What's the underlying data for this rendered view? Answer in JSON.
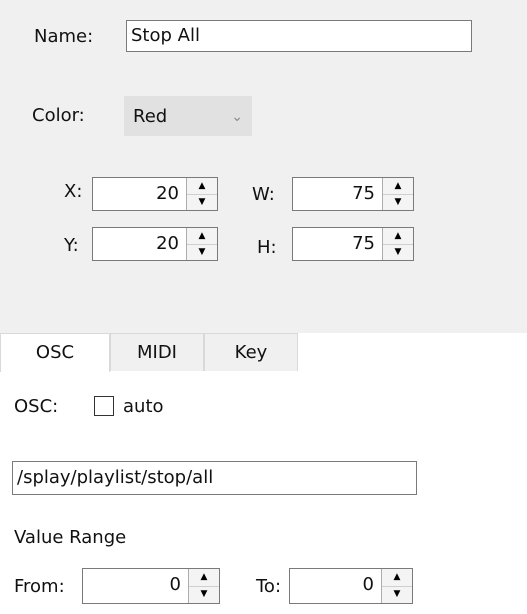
{
  "name": {
    "label": "Name:",
    "value": "Stop All"
  },
  "color": {
    "label": "Color:",
    "value": "Red"
  },
  "position": {
    "x_label": "X:",
    "x_value": "20",
    "y_label": "Y:",
    "y_value": "20",
    "w_label": "W:",
    "w_value": "75",
    "h_label": "H:",
    "h_value": "75"
  },
  "tabs": [
    {
      "label": "OSC",
      "active": true
    },
    {
      "label": "MIDI",
      "active": false
    },
    {
      "label": "Key",
      "active": false
    }
  ],
  "osc": {
    "label": "OSC:",
    "auto_label": "auto",
    "auto_checked": false,
    "address": "/splay/playlist/stop/all"
  },
  "value_range": {
    "heading": "Value Range",
    "from_label": "From:",
    "from_value": "0",
    "to_label": "To:",
    "to_value": "0"
  }
}
